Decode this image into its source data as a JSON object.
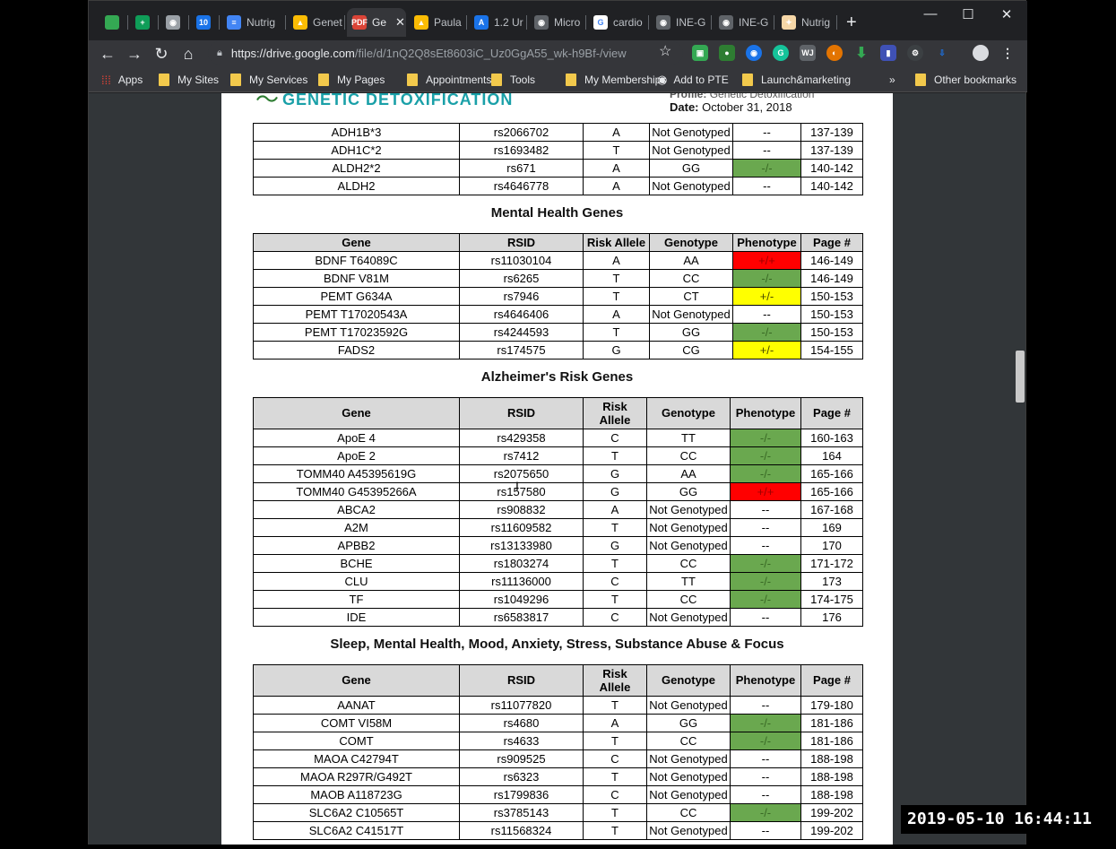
{
  "tabs": [
    {
      "label": "",
      "favicon_color": "#34a853",
      "favicon_text": ""
    },
    {
      "label": "",
      "favicon_color": "#0f9d58",
      "favicon_text": "+"
    },
    {
      "label": "",
      "favicon_color": "#9aa0a6",
      "favicon_text": "◉"
    },
    {
      "label": "",
      "favicon_color": "#1a73e8",
      "favicon_text": "10"
    },
    {
      "label": "Nutrig",
      "favicon_color": "#4285f4",
      "favicon_text": "≡"
    },
    {
      "label": "Genet",
      "favicon_color": "#fbbc04",
      "favicon_text": "▲"
    },
    {
      "label": "Ge",
      "favicon_color": "#db4437",
      "favicon_text": "PDF",
      "active": true
    },
    {
      "label": "Paula",
      "favicon_color": "#fbbc04",
      "favicon_text": "▲"
    },
    {
      "label": "1.2 Ur",
      "favicon_color": "#1a73e8",
      "favicon_text": "A"
    },
    {
      "label": "Micro",
      "favicon_color": "#5f6368",
      "favicon_text": "◉"
    },
    {
      "label": "cardio",
      "favicon_color": "#ffffff",
      "favicon_text": "G"
    },
    {
      "label": "INE-G",
      "favicon_color": "#5f6368",
      "favicon_text": "◉"
    },
    {
      "label": "INE-G",
      "favicon_color": "#5f6368",
      "favicon_text": "◉"
    },
    {
      "label": "Nutrig",
      "favicon_color": "#f6d7a7",
      "favicon_text": "✦"
    }
  ],
  "url": {
    "host": "https://drive.google.com",
    "path": "/file/d/1nQ2Q8sEt8603iC_Uz0GgA55_wk-h9Bf-/view"
  },
  "bookmarks": {
    "apps": "Apps",
    "items": [
      "My Sites",
      "My Services",
      "My Pages",
      "Appointments",
      "Tools",
      "My Memberships",
      "Add to PTE",
      "Launch&marketing"
    ],
    "more": "»",
    "other": "Other bookmarks"
  },
  "pdf": {
    "logo_text": "GENETIC DETOXIFICATION",
    "profile_label": "Profile:",
    "profile_value": "Genetic Detoxification",
    "date_label": "Date:",
    "date_value": "October 31, 2018",
    "table0": {
      "rows": [
        [
          "ADH1B*3",
          "rs2066702",
          "A",
          "Not Genotyped",
          "--",
          "137-139",
          ""
        ],
        [
          "ADH1C*2",
          "rs1693482",
          "T",
          "Not Genotyped",
          "--",
          "137-139",
          ""
        ],
        [
          "ALDH2*2",
          "rs671",
          "A",
          "GG",
          "-/-",
          "140-142",
          "green"
        ],
        [
          "ALDH2",
          "rs4646778",
          "A",
          "Not Genotyped",
          "--",
          "140-142",
          ""
        ]
      ]
    },
    "section1_title": "Mental Health Genes",
    "table1": {
      "headers": [
        "Gene",
        "RSID",
        "Risk Allele",
        "Genotype",
        "Phenotype",
        "Page #"
      ],
      "rows": [
        [
          "BDNF T64089C",
          "rs11030104",
          "A",
          "AA",
          "+/+",
          "146-149",
          "red"
        ],
        [
          "BDNF V81M",
          "rs6265",
          "T",
          "CC",
          "-/-",
          "146-149",
          "green"
        ],
        [
          "PEMT G634A",
          "rs7946",
          "T",
          "CT",
          "+/-",
          "150-153",
          "yellow"
        ],
        [
          "PEMT T17020543A",
          "rs4646406",
          "A",
          "Not Genotyped",
          "--",
          "150-153",
          ""
        ],
        [
          "PEMT T17023592G",
          "rs4244593",
          "T",
          "GG",
          "-/-",
          "150-153",
          "green"
        ],
        [
          "FADS2",
          "rs174575",
          "G",
          "CG",
          "+/-",
          "154-155",
          "yellow"
        ]
      ]
    },
    "section2_title": "Alzheimer's Risk Genes",
    "table2": {
      "headers": [
        "Gene",
        "RSID",
        "Risk",
        "Allele",
        "Genotype",
        "Phenotype",
        "Page #"
      ],
      "rows": [
        [
          "ApoE 4",
          "rs429358",
          "C",
          "TT",
          "-/-",
          "160-163",
          "green"
        ],
        [
          "ApoE 2",
          "rs7412",
          "T",
          "CC",
          "-/-",
          "164",
          "green"
        ],
        [
          "TOMM40 A45395619G",
          "rs2075650",
          "G",
          "AA",
          "-/-",
          "165-166",
          "green"
        ],
        [
          "TOMM40 G45395266A",
          "rs157580",
          "G",
          "GG",
          "+/+",
          "165-166",
          "red"
        ],
        [
          "ABCA2",
          "rs908832",
          "A",
          "Not Genotyped",
          "--",
          "167-168",
          ""
        ],
        [
          "A2M",
          "rs11609582",
          "T",
          "Not Genotyped",
          "--",
          "169",
          ""
        ],
        [
          "APBB2",
          "rs13133980",
          "G",
          "Not Genotyped",
          "--",
          "170",
          ""
        ],
        [
          "BCHE",
          "rs1803274",
          "T",
          "CC",
          "-/-",
          "171-172",
          "green"
        ],
        [
          "CLU",
          "rs11136000",
          "C",
          "TT",
          "-/-",
          "173",
          "green"
        ],
        [
          "TF",
          "rs1049296",
          "T",
          "CC",
          "-/-",
          "174-175",
          "green"
        ],
        [
          "IDE",
          "rs6583817",
          "C",
          "Not Genotyped",
          "--",
          "176",
          ""
        ]
      ]
    },
    "section3_title": "Sleep, Mental Health, Mood, Anxiety, Stress, Substance Abuse & Focus",
    "table3": {
      "headers": [
        "Gene",
        "RSID",
        "Risk",
        "Allele",
        "Genotype",
        "Phenotype",
        "Page #"
      ],
      "rows": [
        [
          "AANAT",
          "rs11077820",
          "T",
          "Not Genotyped",
          "--",
          "179-180",
          ""
        ],
        [
          "COMT VI58M",
          "rs4680",
          "A",
          "GG",
          "-/-",
          "181-186",
          "green"
        ],
        [
          "COMT",
          "rs4633",
          "T",
          "CC",
          "-/-",
          "181-186",
          "green"
        ],
        [
          "MAOA C42794T",
          "rs909525",
          "C",
          "Not Genotyped",
          "--",
          "188-198",
          ""
        ],
        [
          "MAOA R297R/G492T",
          "rs6323",
          "T",
          "Not Genotyped",
          "--",
          "188-198",
          ""
        ],
        [
          "MAOB A118723G",
          "rs1799836",
          "C",
          "Not Genotyped",
          "--",
          "188-198",
          ""
        ],
        [
          "SLC6A2 C10565T",
          "rs3785143",
          "T",
          "CC",
          "-/-",
          "199-202",
          "green"
        ],
        [
          "SLC6A2 C41517T",
          "rs11568324",
          "T",
          "Not Genotyped",
          "--",
          "199-202",
          ""
        ]
      ]
    }
  },
  "timestamp": "2019-05-10 16:44:11",
  "colors": {
    "green": "#6aa84f",
    "red": "#ff0000",
    "yellow": "#ffff00",
    "header_gray": "#d9d9d9",
    "logo_teal": "#1aa0a8"
  }
}
